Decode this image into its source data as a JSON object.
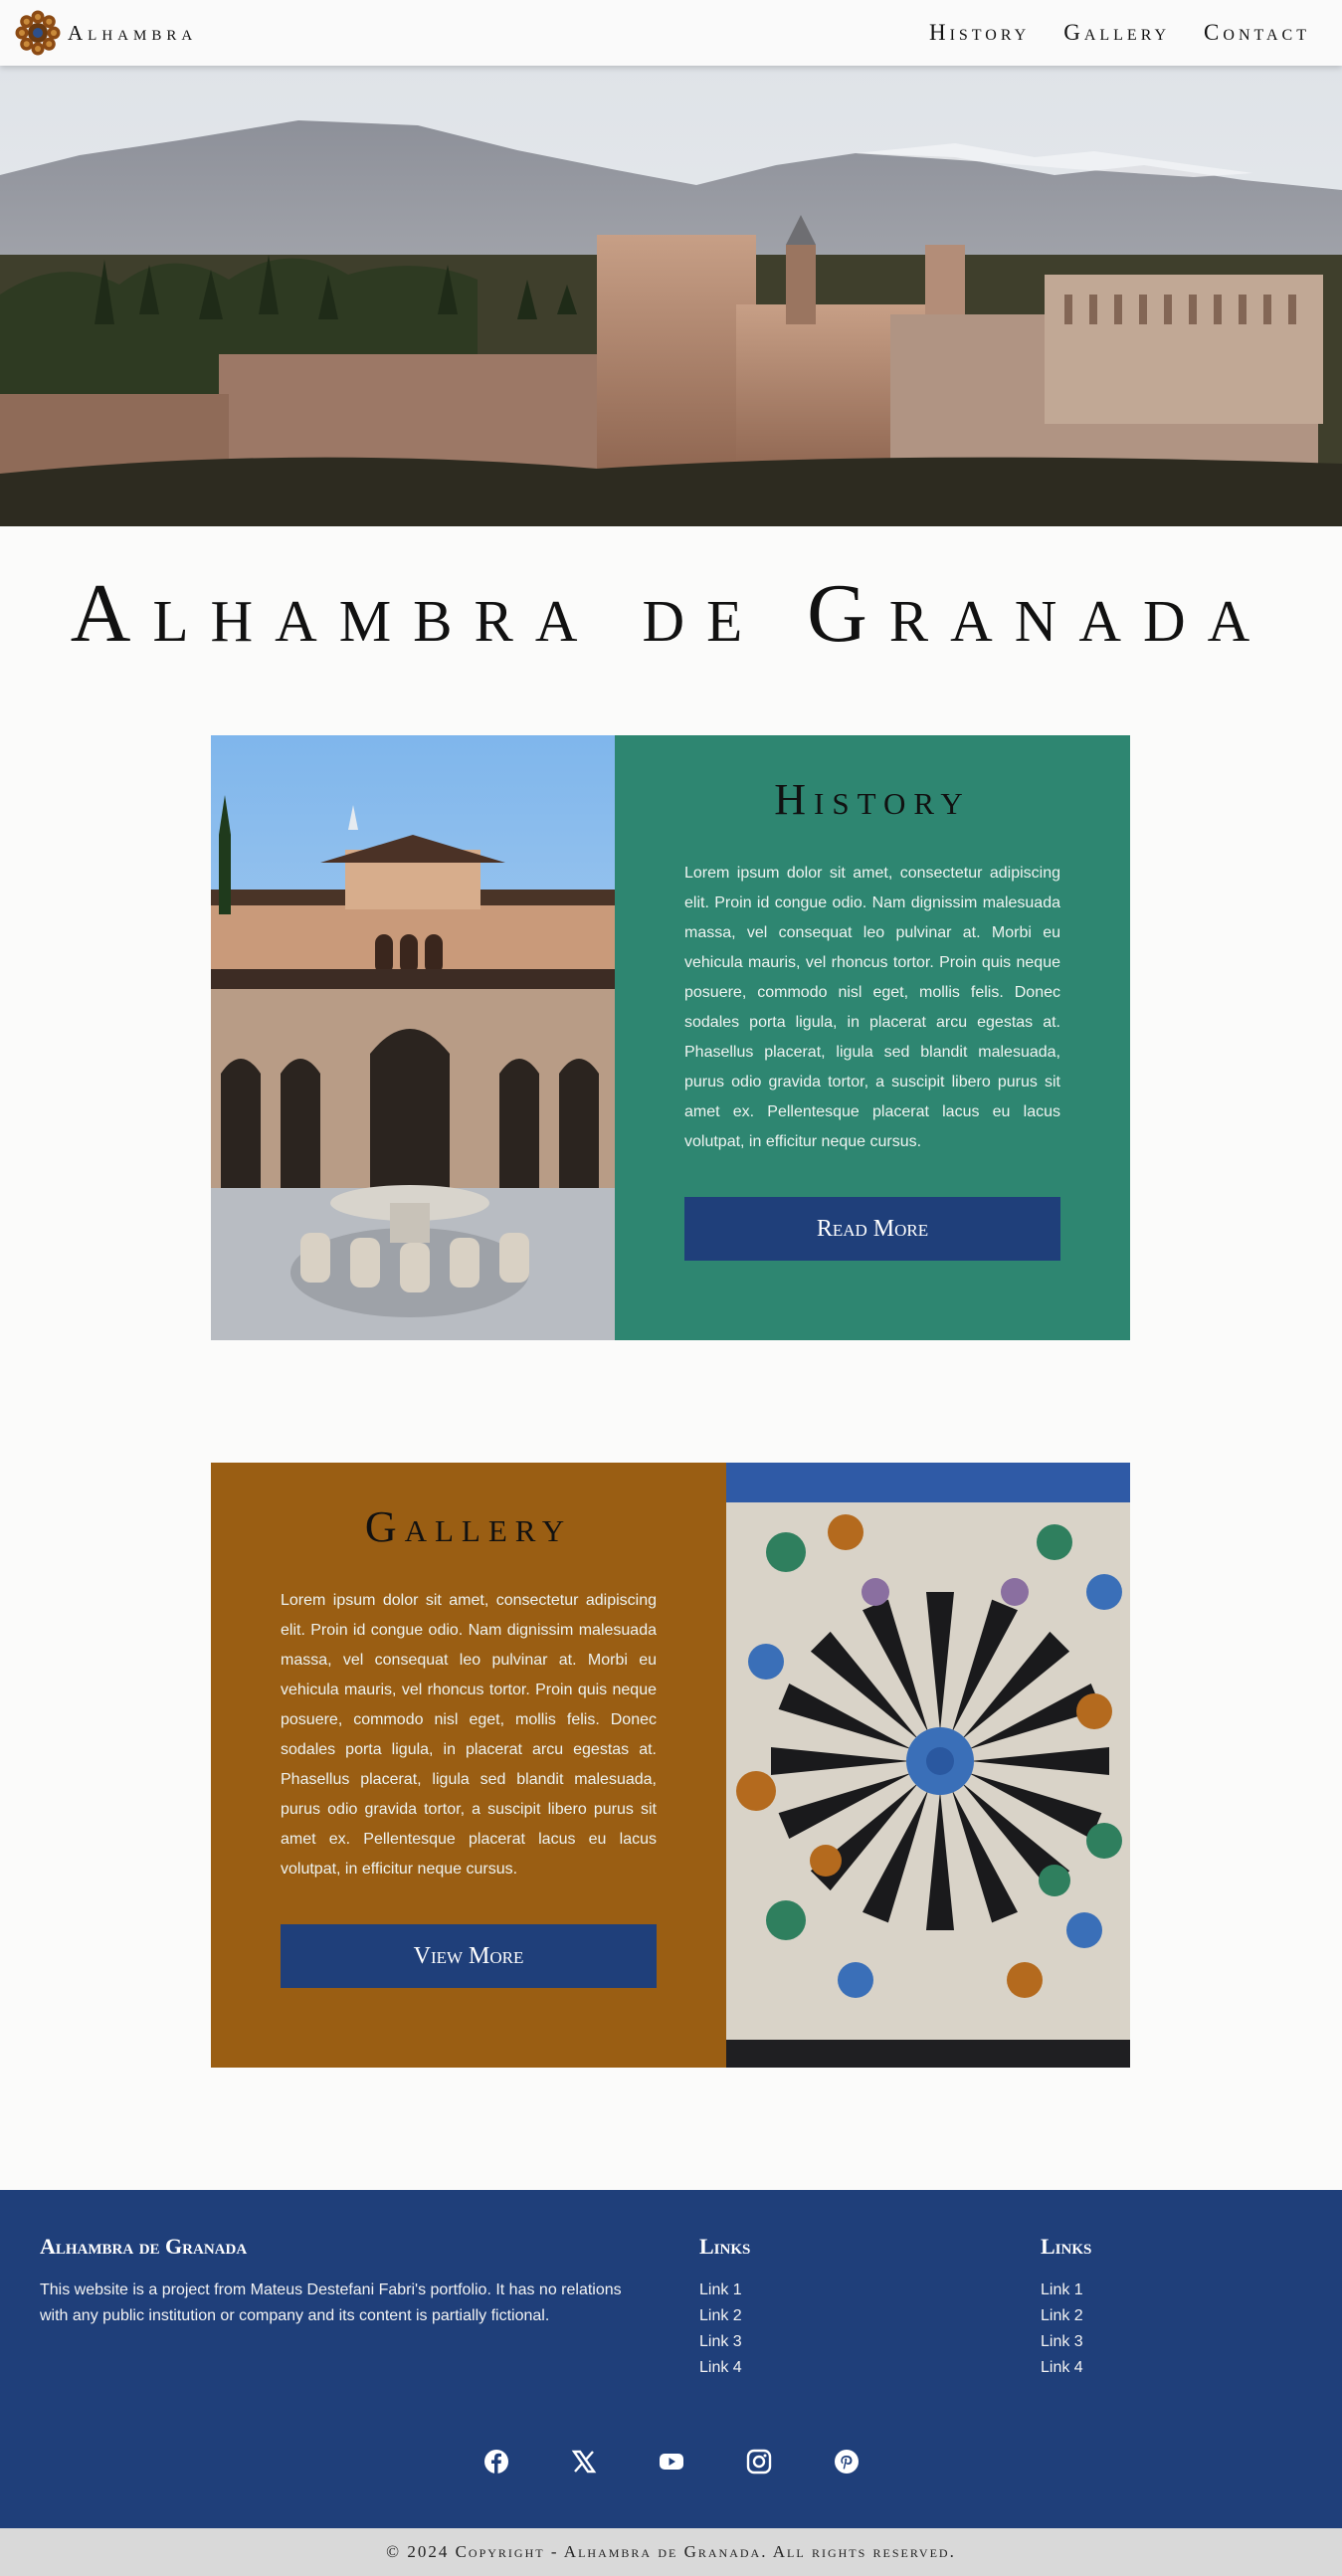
{
  "nav": {
    "logo_text": "Alhambra",
    "links": [
      "History",
      "Gallery",
      "Contact"
    ]
  },
  "page_title": "Alhambra de Granada",
  "history": {
    "title": "History",
    "text": "Lorem ipsum dolor sit amet, consectetur adipiscing elit. Proin id congue odio. Nam dignissim malesuada massa, vel consequat leo pulvinar at. Morbi eu vehicula mauris, vel rhoncus tortor. Proin quis neque posuere, commodo nisl eget, mollis felis. Donec sodales porta ligula, in placerat arcu egestas at. Phasellus placerat, ligula sed blandit malesuada, purus odio gravida tortor, a suscipit libero purus sit amet ex. Pellentesque placerat lacus eu lacus volutpat, in efficitur neque cursus.",
    "button": "Read More"
  },
  "gallery": {
    "title": "Gallery",
    "text": "Lorem ipsum dolor sit amet, consectetur adipiscing elit. Proin id congue odio. Nam dignissim malesuada massa, vel consequat leo pulvinar at. Morbi eu vehicula mauris, vel rhoncus tortor. Proin quis neque posuere, commodo nisl eget, mollis felis. Donec sodales porta ligula, in placerat arcu egestas at. Phasellus placerat, ligula sed blandit malesuada, purus odio gravida tortor, a suscipit libero purus sit amet ex. Pellentesque placerat lacus eu lacus volutpat, in efficitur neque cursus.",
    "button": "View More"
  },
  "footer": {
    "about_title": "Alhambra de Granada",
    "about_text": "This website is a project from Mateus Destefani Fabri's portfolio. It has no relations with any public institution or company and its content is partially fictional.",
    "links1_title": "Links",
    "links1": [
      "Link 1",
      "Link 2",
      "Link 3",
      "Link 4"
    ],
    "links2_title": "Links",
    "links2": [
      "Link 1",
      "Link 2",
      "Link 3",
      "Link 4"
    ],
    "socials": [
      "facebook-icon",
      "x-icon",
      "youtube-icon",
      "instagram-icon",
      "pinterest-icon"
    ],
    "copyright": "© 2024 Copyright - Alhambra de Granada. All rights reserved."
  },
  "colors": {
    "teal": "#2e8671",
    "amber": "#9a5e13",
    "navy": "#1f3f7a",
    "footer_bar": "#d9d9d9"
  }
}
